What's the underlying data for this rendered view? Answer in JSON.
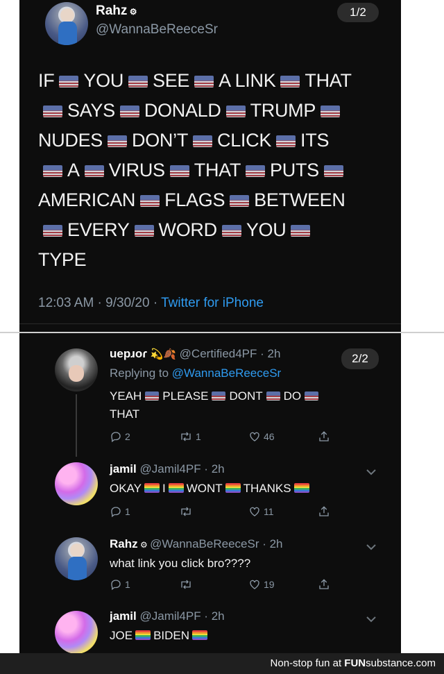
{
  "tweet": {
    "author_name": "Rahz",
    "author_handle": "@WannaBeReeceSr",
    "counter": "1/2",
    "lines": [
      [
        "IF",
        "YOU",
        "SEE",
        "A LINK",
        "THAT"
      ],
      [
        "",
        "SAYS",
        "DONALD",
        "TRUMP",
        ""
      ],
      [
        "NUDES",
        "DON’T",
        "CLICK",
        "ITS"
      ],
      [
        "",
        "A",
        "VIRUS",
        "THAT",
        "PUTS",
        ""
      ],
      [
        "AMERICAN",
        "FLAGS",
        "BETWEEN"
      ],
      [
        "",
        "EVERY",
        "WORD",
        "YOU",
        ""
      ],
      [
        "TYPE"
      ]
    ],
    "time": "12:03 AM · 9/30/20 · ",
    "source": "Twitter for iPhone"
  },
  "thread": {
    "counter": "2/2",
    "replies": [
      {
        "name": "uepɹoɾ",
        "name_icons": "💫🍂",
        "handle": "@Certified4PF · 2h",
        "replying_prefix": "Replying to ",
        "replying_handle": "@WannaBeReeceSr",
        "text_words": [
          "YEAH",
          "PLEASE",
          "DONT",
          "DO"
        ],
        "text_line2": "THAT",
        "replies": "2",
        "retweets": "1",
        "likes": "46"
      },
      {
        "name": "jamil",
        "handle": "@Jamil4PF · 2h",
        "text_words": [
          "OKAY",
          "I",
          "WONT",
          "THANKS"
        ],
        "replies": "1",
        "retweets": "",
        "likes": "11"
      },
      {
        "name": "Rahz",
        "handle": "@WannaBeReeceSr · 2h",
        "text": "what link you click bro????",
        "replies": "1",
        "retweets": "",
        "likes": "19"
      },
      {
        "name": "jamil",
        "handle": "@Jamil4PF · 2h",
        "text_words": [
          "JOE",
          "BIDEN"
        ]
      }
    ]
  },
  "footer": {
    "prefix": "Non-stop fun at ",
    "brand_bold": "FUN",
    "brand_rest": "substance.com"
  },
  "colors": {
    "background": "#0d0d0d",
    "handle_gray": "#8b98a5",
    "link_blue": "#2f9bf0"
  },
  "icons": [
    "reply-icon",
    "retweet-icon",
    "like-icon",
    "share-icon",
    "chevron-down-icon",
    "us-flag-emoji",
    "rainbow-flag-emoji"
  ]
}
